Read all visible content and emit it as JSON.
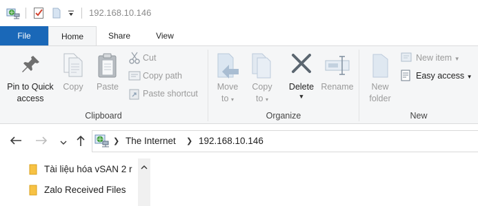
{
  "window": {
    "title": "192.168.10.146"
  },
  "quick_access_toolbar": {
    "icons": [
      "network-drive-icon",
      "properties-checkbox-icon",
      "new-folder-icon",
      "customize-dropdown-icon"
    ]
  },
  "tabs": [
    {
      "label": "File",
      "active": false,
      "accent": "#1a68b8"
    },
    {
      "label": "Home",
      "active": true
    },
    {
      "label": "Share",
      "active": false
    },
    {
      "label": "View",
      "active": false
    }
  ],
  "ribbon": {
    "clipboard": {
      "label": "Clipboard",
      "pin_to_quick_access": {
        "line1": "Pin to Quick",
        "line2": "access"
      },
      "copy": "Copy",
      "paste": "Paste",
      "cut": "Cut",
      "copy_path": "Copy path",
      "paste_shortcut": "Paste shortcut"
    },
    "organize": {
      "label": "Organize",
      "move_to": {
        "line1": "Move",
        "line2": "to"
      },
      "copy_to": {
        "line1": "Copy",
        "line2": "to"
      },
      "delete": "Delete",
      "rename": "Rename"
    },
    "new": {
      "label": "New",
      "new_folder": {
        "line1": "New",
        "line2": "folder"
      },
      "new_item": "New item",
      "easy_access": "Easy access"
    }
  },
  "navigation": {
    "breadcrumb": [
      "The Internet",
      "192.168.10.146"
    ]
  },
  "files": [
    {
      "name": "Tài liệu hóa vSAN 2 r",
      "type": "folder"
    },
    {
      "name": "Zalo Received Files",
      "type": "folder"
    }
  ]
}
